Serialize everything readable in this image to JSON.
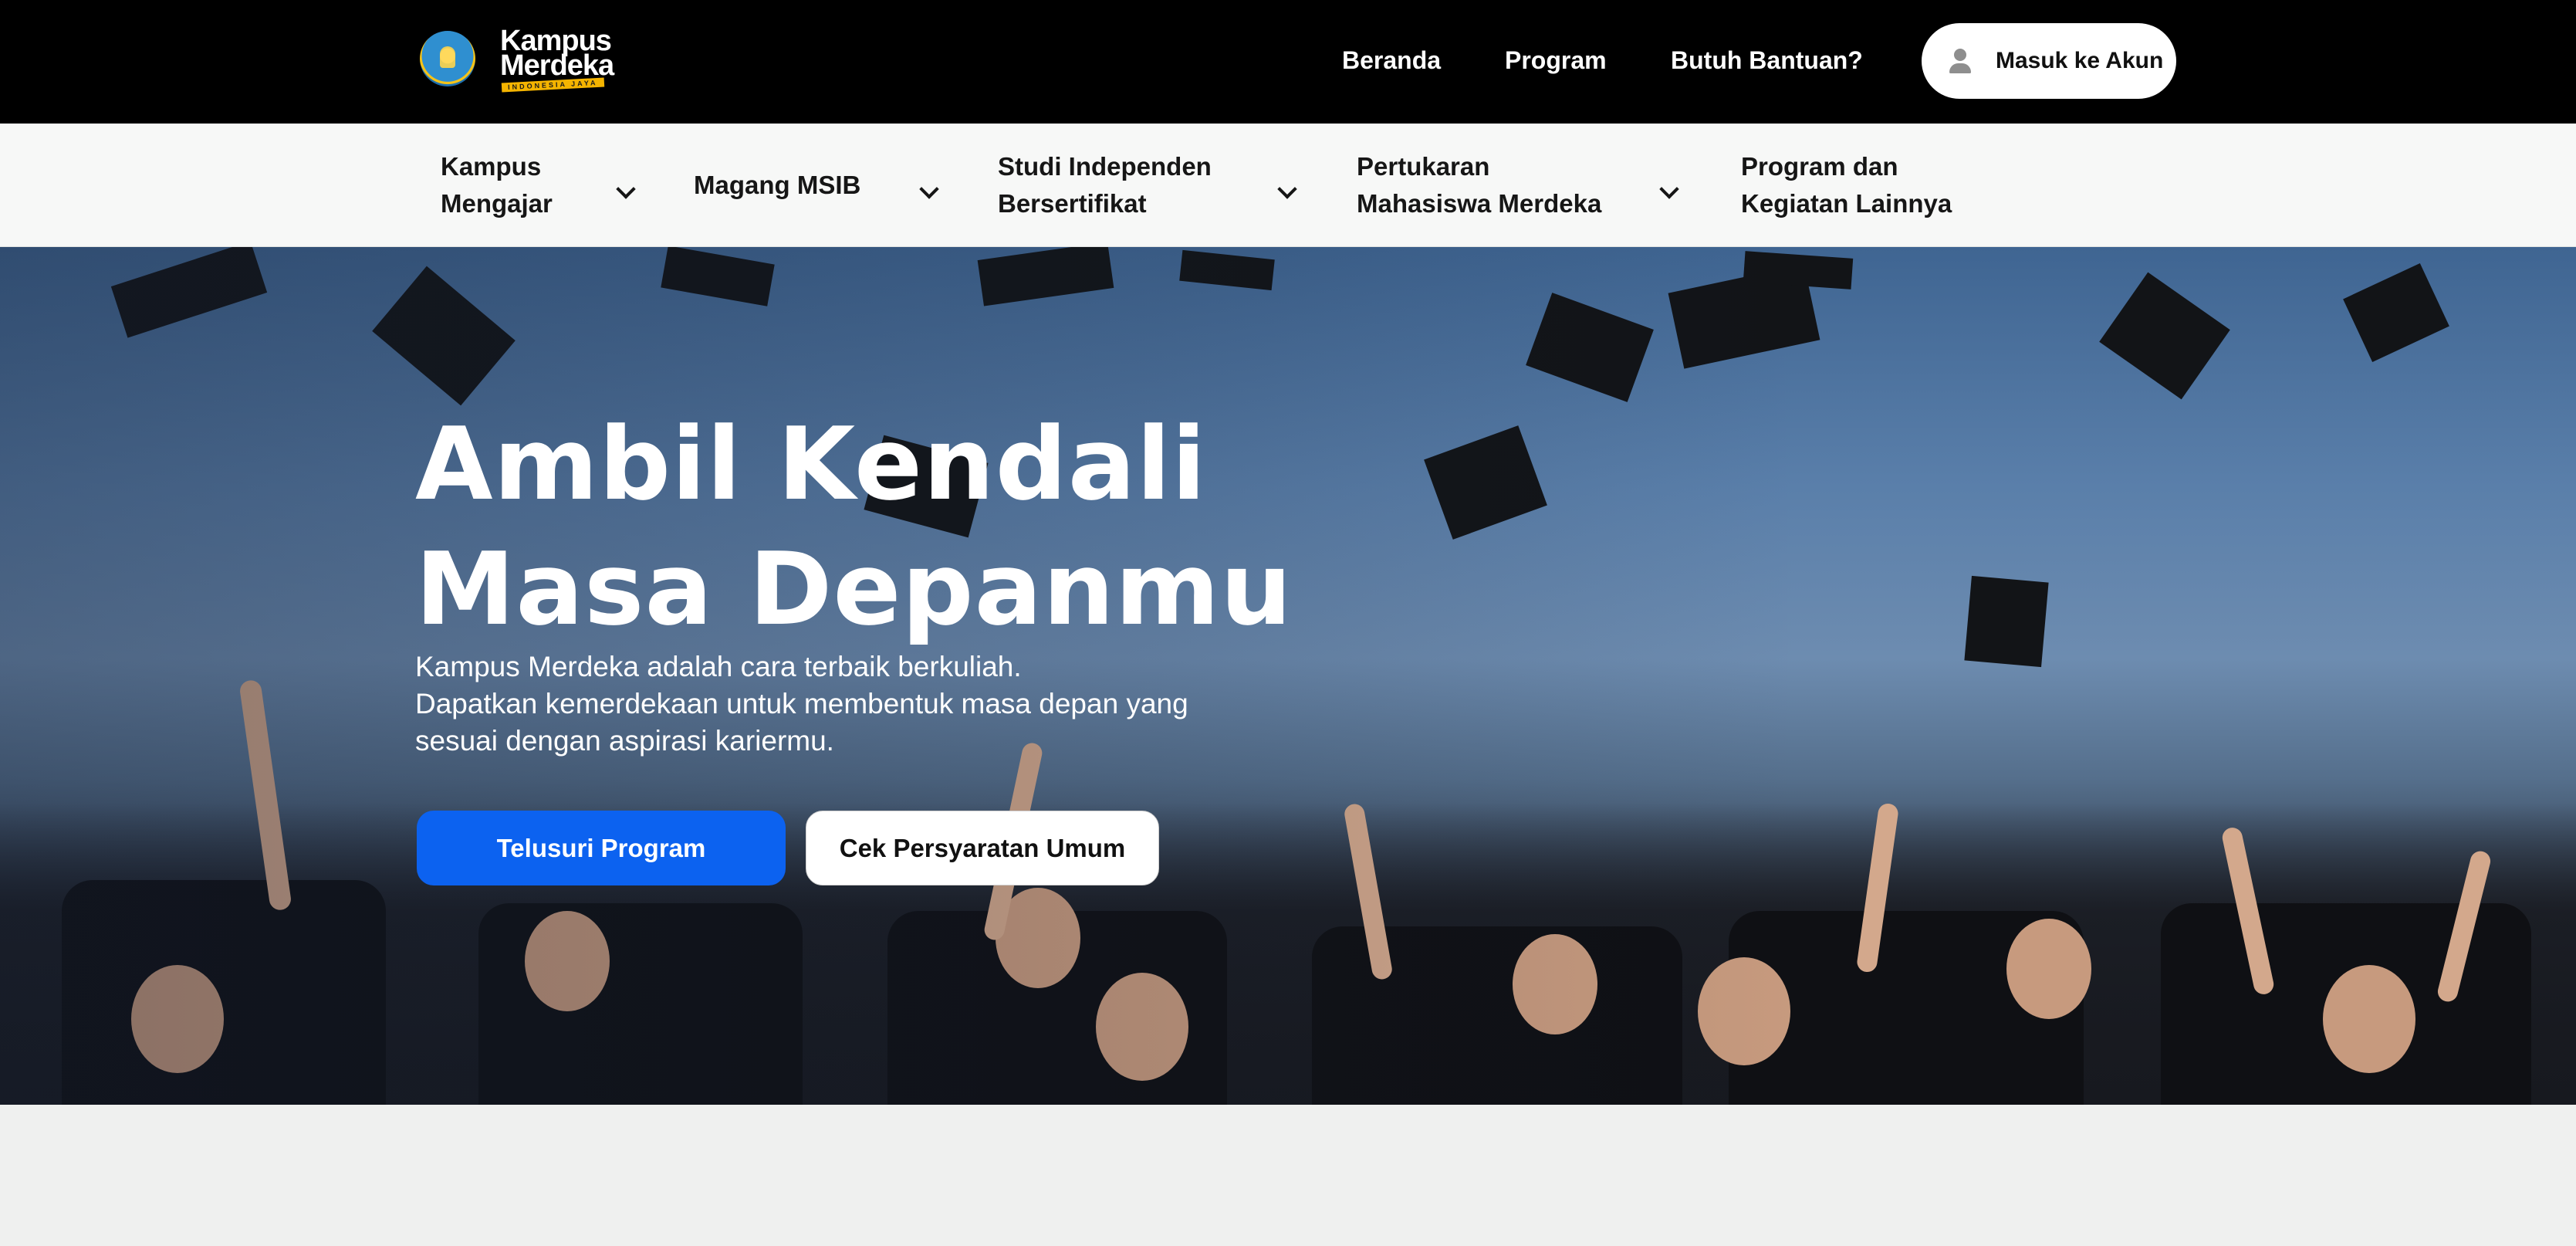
{
  "brand": {
    "line1": "Kampus",
    "line2": "Merdeka",
    "tagline": "INDONESIA JAYA",
    "logo_icon": "tut-wuri-handayani-emblem-icon"
  },
  "topnav": {
    "items": [
      {
        "label": "Beranda"
      },
      {
        "label": "Program"
      },
      {
        "label": "Butuh Bantuan?"
      }
    ],
    "login": {
      "label": "Masuk ke Akun",
      "icon": "user-icon"
    }
  },
  "subnav": {
    "items": [
      {
        "label": "Kampus Mengajar",
        "has_dropdown": true
      },
      {
        "label": "Magang MSIB",
        "has_dropdown": true
      },
      {
        "label": "Studi Independen Bersertifikat",
        "has_dropdown": true
      },
      {
        "label": "Pertukaran Mahasiswa Merdeka",
        "has_dropdown": true
      },
      {
        "label": "Program dan Kegiatan Lainnya",
        "has_dropdown": false
      }
    ]
  },
  "hero": {
    "title_line1": "Ambil Kendali",
    "title_line2": "Masa Depanmu",
    "subtitle_line1": "Kampus Merdeka adalah cara terbaik berkuliah.",
    "subtitle_line2": "Dapatkan kemerdekaan untuk membentuk masa depan yang sesuai dengan aspirasi kariermu.",
    "primary_button": "Telusuri Program",
    "secondary_button": "Cek Persyaratan Umum"
  },
  "colors": {
    "topbar_bg": "#000000",
    "subnav_bg": "#f7f8f7",
    "primary": "#0c62f0",
    "page_bg": "#eff0ef"
  }
}
